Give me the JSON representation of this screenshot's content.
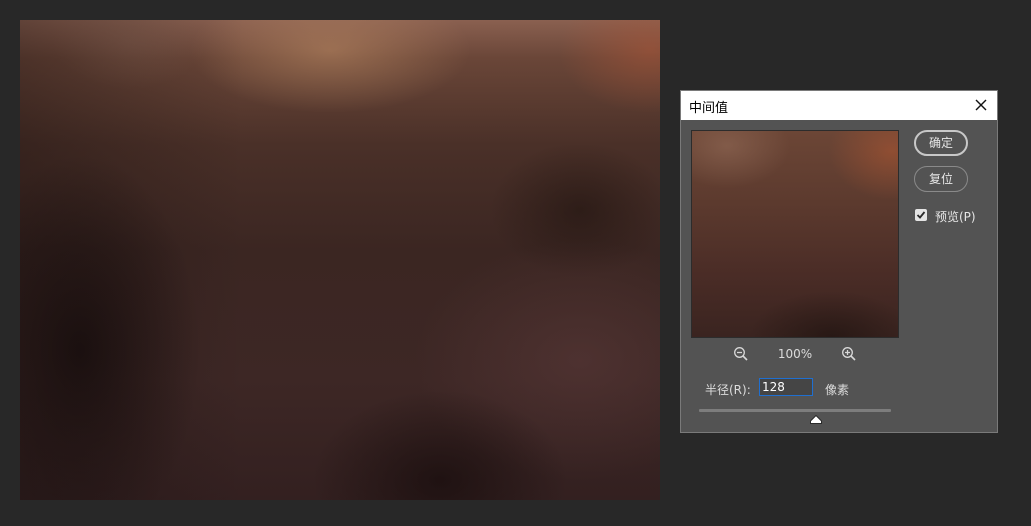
{
  "dialog": {
    "title": "中间值",
    "zoom": {
      "level": "100%",
      "zoom_out_icon": "zoom-out-magnifier",
      "zoom_in_icon": "zoom-in-magnifier"
    },
    "radius": {
      "label": "半径(R):",
      "value": "128",
      "unit": "像素",
      "slider_fraction": 0.61
    },
    "buttons": {
      "ok_label": "确定",
      "reset_label": "复位"
    },
    "preview_option": {
      "label": "预览(P)",
      "checked": true
    },
    "close_icon": "close-x"
  },
  "colors": {
    "app_background": "#282828",
    "dialog_background": "#535353",
    "titlebar_background": "#ffffff",
    "input_focus_border": "#1f6fd0"
  }
}
